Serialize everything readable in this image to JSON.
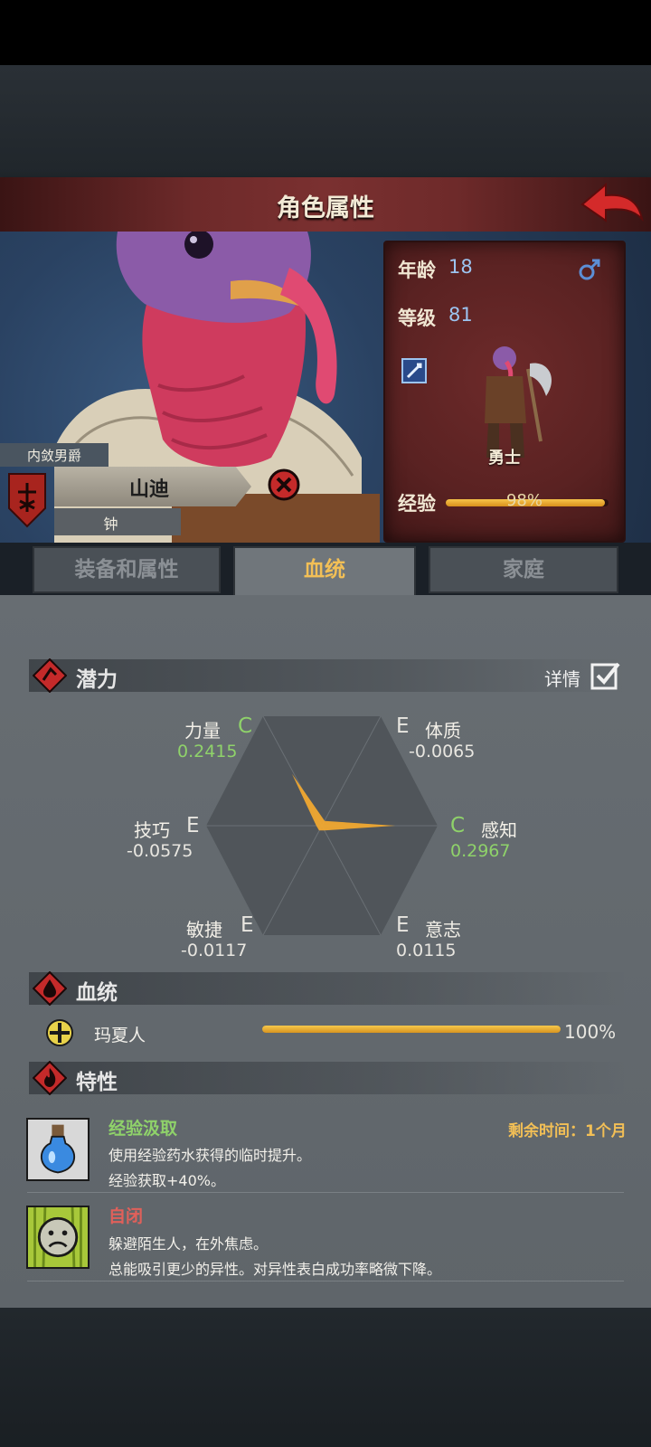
{
  "header": {
    "title": "角色属性"
  },
  "character": {
    "noble_title": "内敛男爵",
    "name": "山迪",
    "sub_name": "钟",
    "age_label": "年龄",
    "age": "18",
    "level_label": "等级",
    "level": "81",
    "class_name": "勇士",
    "xp_label": "经验",
    "xp_text": "98%",
    "xp_fraction": 0.98
  },
  "tabs": [
    {
      "label": "装备和属性",
      "active": false
    },
    {
      "label": "血统",
      "active": true
    },
    {
      "label": "家庭",
      "active": false
    }
  ],
  "potential": {
    "label": "潜力",
    "details_label": "详情",
    "stats": {
      "strength": {
        "name": "力量",
        "grade": "C",
        "value": "0.2415"
      },
      "constitution": {
        "name": "体质",
        "grade": "E",
        "value": "-0.0065"
      },
      "skill": {
        "name": "技巧",
        "grade": "E",
        "value": "-0.0575"
      },
      "perception": {
        "name": "感知",
        "grade": "C",
        "value": "0.2967"
      },
      "agility": {
        "name": "敏捷",
        "grade": "E",
        "value": "-0.0117"
      },
      "will": {
        "name": "意志",
        "grade": "E",
        "value": "0.0115"
      }
    }
  },
  "bloodline": {
    "label": "血统",
    "entry_name": "玛夏人",
    "entry_percent": "100%",
    "entry_fraction": 1.0
  },
  "traits": {
    "label": "特性",
    "items": [
      {
        "name": "经验汲取",
        "remaining": "剩余时间：1个月",
        "line1": "使用经验药水获得的临时提升。",
        "line2": "经验获取+40%。"
      },
      {
        "name": "自闭",
        "line1": "躲避陌生人，在外焦虑。",
        "line2": "总能吸引更少的异性。对异性表白成功率略微下降。"
      }
    ]
  },
  "colors": {
    "accent_gold": "#f2bf56",
    "grade_green": "#8fd26a",
    "trait_positive": "#8fd26a",
    "trait_negative": "#e0605a",
    "title_red": "#7a3030"
  },
  "icons": [
    "back-arrow-icon",
    "male-icon",
    "sword-icon",
    "crest-icon",
    "remove-icon",
    "potential-icon",
    "checkbox-icon",
    "blood-drop-icon",
    "bloodline-emblem-icon",
    "flame-icon",
    "potion-icon",
    "sad-face-icon"
  ]
}
